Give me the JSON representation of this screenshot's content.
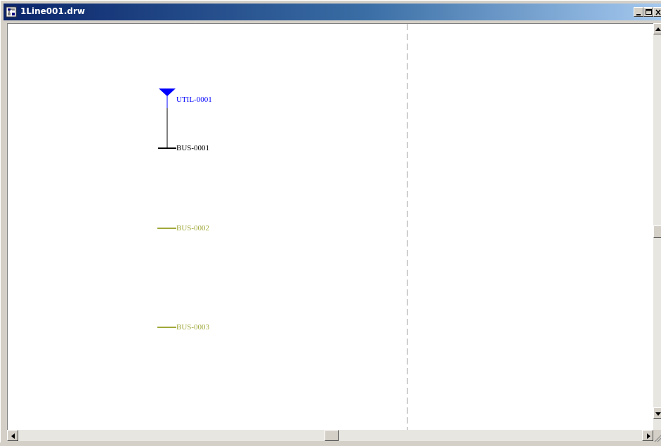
{
  "window": {
    "title": "1Line001.drw"
  },
  "diagram": {
    "utility_label": "UTIL-0001",
    "bus1_label": "BUS-0001",
    "bus2_label": "BUS-0002",
    "bus3_label": "BUS-0003"
  },
  "colors": {
    "utility": "#0000ff",
    "energized": "#000000",
    "deenergized": "#a0a838",
    "page_boundary": "#a0a0a0"
  },
  "icons": {
    "app": "drawing-document-icon",
    "minimize": "minimize-icon",
    "maximize": "maximize-icon",
    "close": "close-icon"
  }
}
